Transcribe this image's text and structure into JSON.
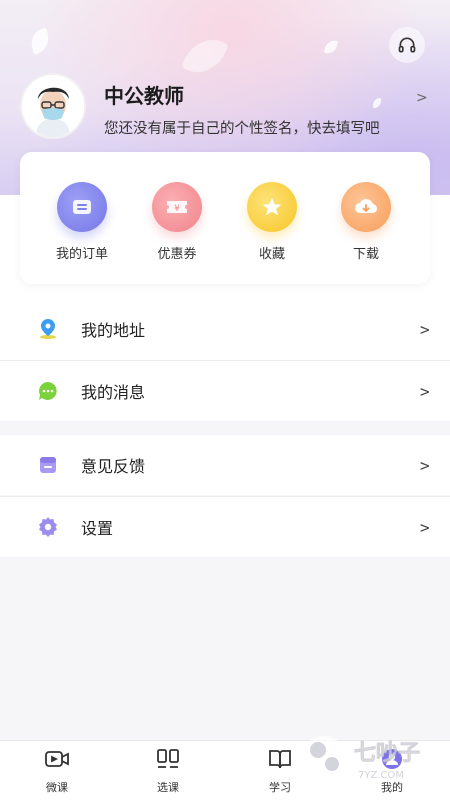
{
  "profile": {
    "name": "中公教师",
    "signature": "您还没有属于自己的个性签名，快去填写吧",
    "arrow": ">"
  },
  "quick_actions": [
    {
      "label": "我的订单",
      "icon": "order-icon",
      "color": "#8a8cf0"
    },
    {
      "label": "优惠券",
      "icon": "coupon-icon",
      "color": "#f49aa0"
    },
    {
      "label": "收藏",
      "icon": "star-icon",
      "color": "#fbd34a"
    },
    {
      "label": "下载",
      "icon": "download-icon",
      "color": "#fbae74"
    }
  ],
  "menu": {
    "group1": [
      {
        "label": "我的地址",
        "icon": "location-icon"
      },
      {
        "label": "我的消息",
        "icon": "message-icon"
      }
    ],
    "group2": [
      {
        "label": "意见反馈",
        "icon": "feedback-icon"
      },
      {
        "label": "设置",
        "icon": "gear-icon"
      }
    ],
    "arrow": ">"
  },
  "tabbar": [
    {
      "label": "微课",
      "icon": "video-icon"
    },
    {
      "label": "选课",
      "icon": "courses-icon"
    },
    {
      "label": "学习",
      "icon": "book-icon"
    },
    {
      "label": "我的",
      "icon": "profile-icon",
      "active": true
    }
  ],
  "watermark": {
    "text": "七吵子",
    "sub": "7YZ.COM"
  },
  "colors": {
    "accent": "#7b72e8",
    "background": "#f6f6f8"
  }
}
